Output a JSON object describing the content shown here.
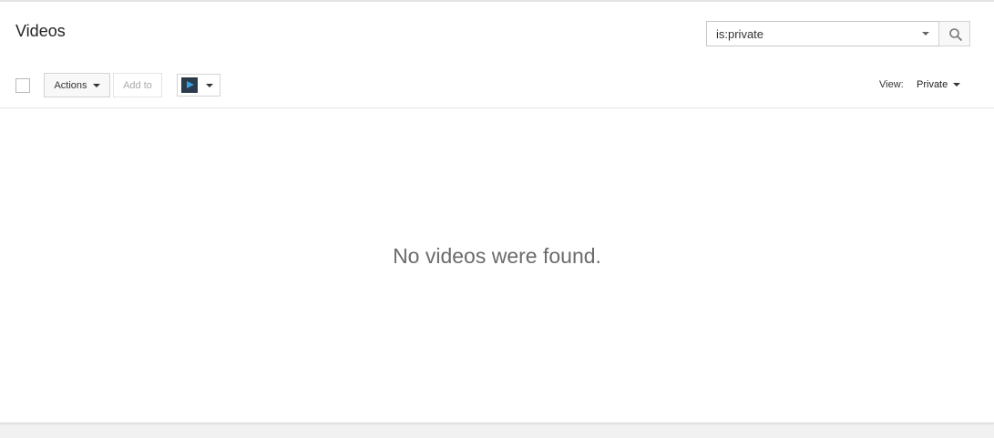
{
  "header": {
    "title": "Videos"
  },
  "search": {
    "value": "is:private",
    "icon": "search-icon"
  },
  "toolbar": {
    "actions_label": "Actions",
    "add_to_label": "Add to",
    "source_icon": "video-app-icon"
  },
  "view": {
    "label": "View:",
    "selected": "Private"
  },
  "main": {
    "empty_message": "No videos were found."
  },
  "colors": {
    "panel_background": "#ffffff",
    "page_background": "#f1f1f1",
    "empty_text": "#6b6b6b"
  }
}
